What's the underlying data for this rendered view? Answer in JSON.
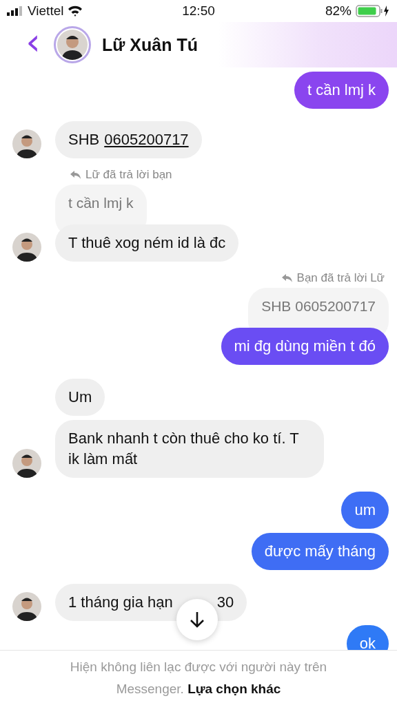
{
  "status_bar": {
    "carrier": "Viettel",
    "time": "12:50",
    "battery": "82%"
  },
  "header": {
    "back": "‹",
    "name": "Lữ Xuân Tú"
  },
  "messages": [
    {
      "kind": "out",
      "text": "t cần lmj k",
      "color": "#8a45ef"
    },
    {
      "kind": "in",
      "text": "SHB",
      "link": "0605200717",
      "avatar": true
    },
    {
      "kind": "note_in",
      "text": "Lữ đã trả lời bạn"
    },
    {
      "kind": "quote_in",
      "text": "t cần lmj k"
    },
    {
      "kind": "in",
      "text": "T thuê xog ném id là đc",
      "avatar": true
    },
    {
      "kind": "note_out",
      "text": "Bạn đã trả lời Lữ"
    },
    {
      "kind": "quote_out",
      "text": "SHB 0605200717"
    },
    {
      "kind": "out",
      "text": "mi đg dùng miền t đó",
      "color": "#6a4df3"
    },
    {
      "kind": "in",
      "text": "Um",
      "avatar": false
    },
    {
      "kind": "in",
      "text": "Bank nhanh t còn thuê cho ko tí. T ik làm mất",
      "avatar": true
    },
    {
      "kind": "out",
      "text": "um",
      "color": "#3e6ef5"
    },
    {
      "kind": "out",
      "text": "được mấy tháng",
      "color": "#3f6df4"
    },
    {
      "kind": "in",
      "text": "1 tháng gia hạn",
      "tail": "30",
      "avatar": true
    },
    {
      "kind": "out",
      "text": "ok",
      "color": "#2f7af6"
    }
  ],
  "footer": {
    "text": "Hiện không liên lạc được với người này trên Messenger.",
    "link": "Lựa chọn khác"
  }
}
